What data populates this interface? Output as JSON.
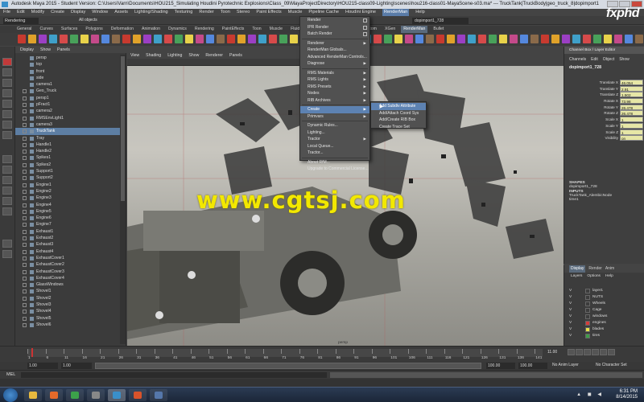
{
  "window": {
    "title": "Autodesk Maya 2015 - Student Version: C:\\Users\\Varn\\Documents\\HOU215_Simulating Houdini Pyrotechnic Explosions\\Class_09\\MayaProjectDirectory\\HOU215-class09-Lighting\\scenes\\hou216-class01-MayaScene-s03.ma* --- TruckTank|TruckBody|geo_truck_8|dopimport1"
  },
  "branding": {
    "watermark_top": "fxphd",
    "watermark_center": "www.cgtsj.com"
  },
  "menubar": [
    "File",
    "Edit",
    "Modify",
    "Create",
    "Display",
    "Window",
    "Assets",
    "Lighting/Shading",
    "Texturing",
    "Render",
    "Toon",
    "Stereo",
    "Paint Effects",
    "Muscle",
    "Pipeline Cache",
    "Houdini Engine",
    "RenderMan",
    "Help"
  ],
  "statusline": {
    "mode": "Rendering",
    "object_field": "dopimport1_728",
    "all_objects": "All objects"
  },
  "shelf_tabs": [
    "General",
    "Curves",
    "Surfaces",
    "Polygons",
    "Deformation",
    "Animation",
    "Dynamics",
    "Rendering",
    "PaintEffects",
    "Toon",
    "Muscle",
    "Fluids",
    "Fur",
    "nHair",
    "nCloth",
    "Custom",
    "XGen",
    "RenderMan",
    "Bullet"
  ],
  "shelf_tabs_selected": "RenderMan",
  "outliner": {
    "menu": [
      "Display",
      "Show",
      "Panels"
    ],
    "items": [
      "persp",
      "top",
      "front",
      "side",
      "camera1",
      "Geo_Truck",
      "persp1",
      "pFract1",
      "camera2",
      "RMSEnvLight1",
      "camera3",
      "TruckTank",
      "Tray",
      "Handle1",
      "Handle2",
      "Spikes1",
      "Spikes2",
      "Support1",
      "Support2",
      "Engine1",
      "Engine2",
      "Engine3",
      "Engine4",
      "Engine5",
      "Engine6",
      "Engine7",
      "Exhaust1",
      "Exhaust2",
      "Exhaust3",
      "Exhaust4",
      "ExhaustCover1",
      "ExhaustCover2",
      "ExhaustCover3",
      "ExhaustCover4",
      "GlassWindows",
      "Shovel1",
      "Shovel2",
      "Shovel3",
      "Shovel4",
      "Shovel5",
      "Shovel6"
    ],
    "selected": "TruckTank"
  },
  "viewport": {
    "menu": [
      "View",
      "Shading",
      "Lighting",
      "Show",
      "Renderer",
      "Panels"
    ],
    "camera_label": "persp"
  },
  "renderman_menu": {
    "items": [
      {
        "label": "Render",
        "box": true
      },
      {
        "label": "IPR Render",
        "box": true
      },
      {
        "label": "Batch Render",
        "box": true
      },
      {
        "label": "Renderer",
        "arrow": true
      },
      {
        "label": "RenderMan Globals...",
        "box": false
      },
      {
        "label": "Advanced RenderMan Controls...",
        "box": false
      },
      {
        "label": "Diagnose",
        "arrow": true
      },
      {
        "label": "RMS Materials",
        "arrow": true
      },
      {
        "label": "RMS Lights",
        "arrow": true
      },
      {
        "label": "RMS Presets",
        "arrow": true
      },
      {
        "label": "Nodes",
        "arrow": true
      },
      {
        "label": "RIB Archives",
        "arrow": true
      },
      {
        "label": "Create",
        "arrow": true,
        "highlight": true
      },
      {
        "label": "Primvars",
        "arrow": true
      },
      {
        "label": "Dynamic Rules...",
        "box": false
      },
      {
        "label": "Lighting...",
        "box": false
      },
      {
        "label": "Tractor",
        "arrow": true
      },
      {
        "label": "Local Queue...",
        "box": false
      },
      {
        "label": "Tractor...",
        "box": false
      },
      {
        "label": "About RfM...",
        "box": false
      },
      {
        "label": "Upgrade to Commercial License...",
        "box": false
      }
    ]
  },
  "create_submenu": [
    "Add Subdiv Attribute",
    "Add/Attach Coord Sys",
    "Add/Create RIB Box",
    "Create Trace Set"
  ],
  "create_submenu_highlight": "Add Subdiv Attribute",
  "channel_box": {
    "tabs": "Channel Box / Layer Editor",
    "menu": [
      "Channels",
      "Edit",
      "Object",
      "Show"
    ],
    "node": "dopimport1_728",
    "attributes": [
      {
        "name": "Translate X",
        "value": "46.054"
      },
      {
        "name": "Translate Y",
        "value": "2.91"
      },
      {
        "name": "Translate Z",
        "value": "1.502"
      },
      {
        "name": "Rotate X",
        "value": "73.98"
      },
      {
        "name": "Rotate Y",
        "value": "26.478"
      },
      {
        "name": "Rotate Z",
        "value": "26.478"
      },
      {
        "name": "Scale X",
        "value": "1"
      },
      {
        "name": "Scale Y",
        "value": "1"
      },
      {
        "name": "Scale Z",
        "value": "1"
      },
      {
        "name": "Visibility",
        "value": "on"
      }
    ],
    "shapes_header": "SHAPES",
    "shape": "dopimport1_728",
    "inputs_header": "INPUTS",
    "inputs": [
      "TruckTank_AlembicNode",
      "time1"
    ]
  },
  "layers": {
    "tabs": [
      "Display",
      "Render",
      "Anim"
    ],
    "selected_tab": "Display",
    "menu": [
      "Layers",
      "Options",
      "Help"
    ],
    "rows": [
      {
        "vis": "V",
        "name": "layer1",
        "color": "#3c3c3c"
      },
      {
        "vis": "V",
        "name": "NUTS",
        "color": "#3c3c3c"
      },
      {
        "vis": "V",
        "name": "Wheels",
        "color": "#3c3c3c"
      },
      {
        "vis": "V",
        "name": "Cage",
        "color": "#3c3c3c"
      },
      {
        "vis": "V",
        "name": "windows",
        "color": "#3c3c3c"
      },
      {
        "vis": "V",
        "name": "engines",
        "color": "#d63b3b"
      },
      {
        "vis": "V",
        "name": "blades",
        "color": "#e6e04b"
      },
      {
        "vis": "V",
        "name": "tires",
        "color": "#3f9e48"
      }
    ]
  },
  "timeslider": {
    "ticks": [
      "1",
      "6",
      "11",
      "16",
      "21",
      "26",
      "31",
      "36",
      "41",
      "46",
      "51",
      "56",
      "61",
      "66",
      "71",
      "76",
      "81",
      "86",
      "91",
      "96",
      "101",
      "106",
      "111",
      "116",
      "121",
      "126",
      "131",
      "136",
      "141"
    ],
    "current_frame": "11.00"
  },
  "rangebar": {
    "start": "1.00",
    "start2": "1.00",
    "end": "100.00",
    "end2": "100.00",
    "anim_layer": "No Anim Layer",
    "char_set": "No Character Set"
  },
  "cmdline": {
    "label": "MEL"
  },
  "taskbar": {
    "time": "6:31 PM",
    "date": "8/14/2015"
  }
}
